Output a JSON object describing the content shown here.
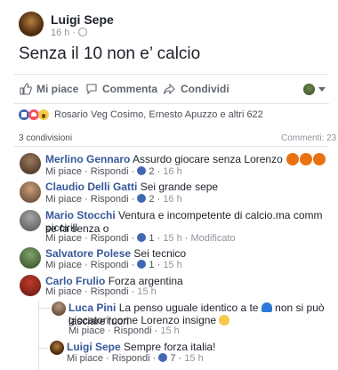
{
  "post": {
    "author": "Luigi Sepe",
    "time": "16 h",
    "separator": "·",
    "text": "Senza il 10 non e’ calcio"
  },
  "actions": {
    "like": "Mi piace",
    "comment": "Commenta",
    "share": "Condividi"
  },
  "reactions": {
    "summary": "Rosario Veg Cosimo, Ernesto Apuzzo e altri 622"
  },
  "counts": {
    "shares": "3 condivisioni",
    "comments": "Commenti: 23"
  },
  "comments": [
    {
      "author": "Merlino Gennaro",
      "text": "Assurdo giocare senza Lorenzo",
      "like": "Mi piace",
      "reply": "Rispondi",
      "likes": "2",
      "time": "16 h"
    },
    {
      "author": "Claudio Delli Gatti",
      "text": "Sei grande sepe",
      "like": "Mi piace",
      "reply": "Rispondi",
      "likes": "2",
      "time": "16 h"
    },
    {
      "author": "Mario Stocchi",
      "text_line1": "Ventura e incompetente di calcio.ma comm se fa senza o",
      "text_line2": "piccirill",
      "like": "Mi piace",
      "reply": "Rispondi",
      "likes": "1",
      "time": "15 h",
      "modified": "Modificato"
    },
    {
      "author": "Salvatore Polese",
      "text": "Sei tecnico",
      "like": "Mi piace",
      "reply": "Rispondi",
      "likes": "1",
      "time": "15 h"
    },
    {
      "author": "Carlo Frulio",
      "text": "Forza argentina",
      "like": "Mi piace",
      "reply": "Rispondi",
      "time": "15 h"
    }
  ],
  "replies": [
    {
      "author": "Luca Pini",
      "text_line1a": "La penso uguale identico a te",
      "text_line1b": "non si può lasciare fuori",
      "text_line2": "giocatori come Lorenzo insigne",
      "like": "Mi piace",
      "reply": "Rispondi",
      "time": "15 h"
    },
    {
      "author": "Luigi Sepe",
      "text": "Sempre forza italia!",
      "like": "Mi piace",
      "reply": "Rispondi",
      "likes": "7",
      "time": "15 h"
    }
  ],
  "colors": {
    "link": "#365899",
    "meta": "#90949c",
    "like_blue": "#4267b2",
    "love_red": "#f25268"
  }
}
